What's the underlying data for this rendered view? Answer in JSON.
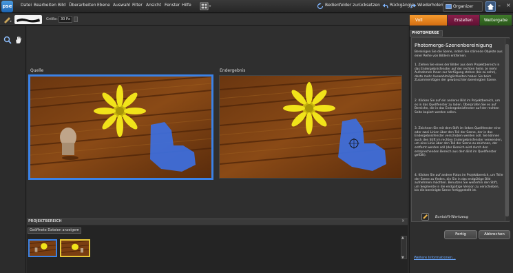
{
  "app": {
    "logo": "pse"
  },
  "menu": [
    "Datei",
    "Bearbeiten",
    "Bild",
    "Überarbeiten",
    "Ebene",
    "Auswahl",
    "Filter",
    "Ansicht",
    "Fenster",
    "Hilfe"
  ],
  "toolbar": {
    "reset_label": "Bedienfelder zurücksetzen",
    "undo_label": "Rückgängig",
    "redo_label": "Wiederholen",
    "organizer_label": "Organizer"
  },
  "options": {
    "size_label": "Größe:",
    "size_value": "30 Px"
  },
  "tabs": {
    "full": "Voll",
    "create": "Erstellen",
    "share": "Weitergabe"
  },
  "workspace": {
    "source_label": "Quelle",
    "result_label": "Endergebnis"
  },
  "bin": {
    "title": "PROJEKTBEREICH",
    "dropdown_value": "Geöffnete Dateien anzeigen",
    "close": "×"
  },
  "panel": {
    "tab": "PHOTOMERGE",
    "title": "Photomerge-Szenenbereinigung",
    "intro": "Bereinigen Sie die Szene, indem Sie störende Objekte aus einer Reihe von Bildern entfernen.",
    "steps": [
      "1. Ziehen Sie eines der Bilder aus dem Projektbereich in das Endergebnisfenster auf der rechten Seite. Je mehr Aufnahmen Ihnen zur Verfügung stehen (bis zu zehn), desto mehr Auswahlmöglichkeiten haben Sie beim Zusammenfügen der gewünschten bereinigten Szene.",
      "2. Klicken Sie auf ein anderes Bild im Projektbereich, um es in das Quellfenster zu laden. Überprüfen Sie es auf Bereiche, die in das Endergebnisfenster auf der rechten Seite kopiert werden sollen.",
      "3. Zeichnen Sie mit dem Stift im linken Quellfenster eine oder zwei Linien über den Teil der Szene, der in das Endergebnisfenster verschoben werden soll. Sie können auch den Stift im rechten Endergebnisfenster verwenden, um eine Linie über den Teil der Szene zu zeichnen, der entfernt werden soll (der Bereich wird durch den entsprechenden Bereich aus dem Bild im Quellfenster gefüllt).",
      "4. Klicken Sie auf andere Fotos im Projektbereich, um Teile der Szene zu finden, die Sie in das endgültige Bild aufnehmen möchten. Benutzen Sie weiterhin den Stift, um Segmente in die endgültige Version zu verschieben, bis die bereinigte Szene fertiggestellt ist."
    ],
    "tool_label": "Buntstift-Werkzeug",
    "ok_label": "Fertig",
    "cancel_label": "Abbrechen",
    "more_info": "Weitere Informationen..."
  },
  "icons": [
    "zoom-icon",
    "hand-icon",
    "view-grid-icon",
    "reset-panels-icon",
    "undo-icon",
    "redo-icon",
    "organizer-icon",
    "home-icon",
    "pencil-icon"
  ],
  "colors": {
    "accent_blue": "#3b82e6",
    "tab_full": "#e8801f",
    "tab_create": "#7a1a42",
    "tab_share": "#3a7226",
    "selected_thumb": "#e8c837"
  }
}
